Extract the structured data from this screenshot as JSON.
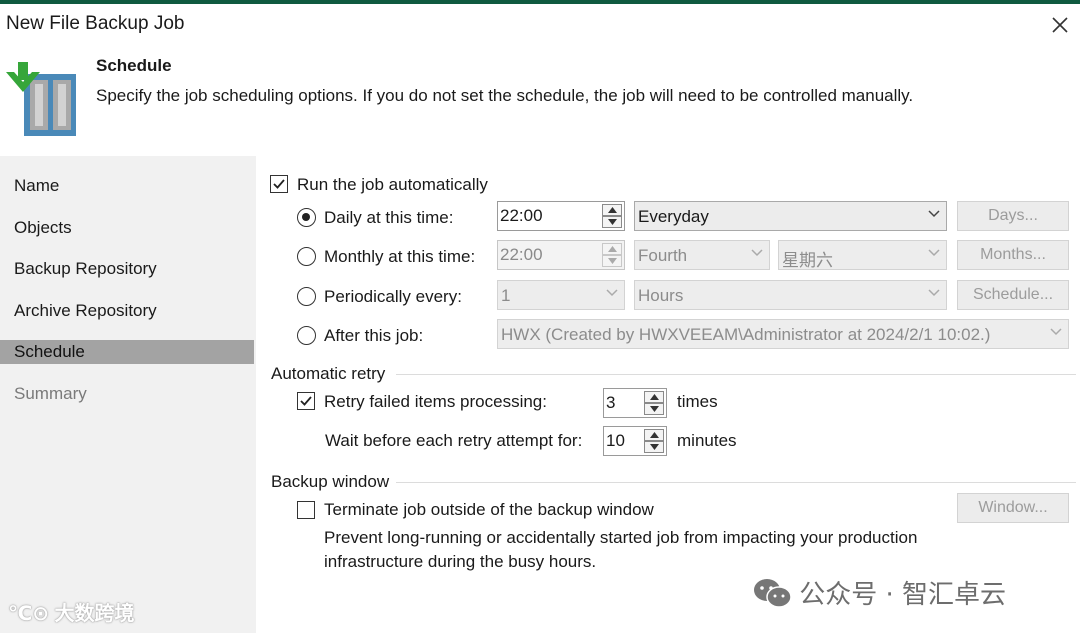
{
  "window": {
    "title": "New File Backup Job",
    "accent_color": "#0f5a40"
  },
  "header": {
    "title": "Schedule",
    "description": "Specify the job scheduling options. If you do not set the schedule, the job will need to be controlled manually.",
    "icon": "backup-job-icon"
  },
  "nav": {
    "items": [
      {
        "label": "Name",
        "state": "normal"
      },
      {
        "label": "Objects",
        "state": "normal"
      },
      {
        "label": "Backup Repository",
        "state": "normal"
      },
      {
        "label": "Archive Repository",
        "state": "normal"
      },
      {
        "label": "Schedule",
        "state": "active"
      },
      {
        "label": "Summary",
        "state": "disabled"
      }
    ]
  },
  "schedule": {
    "run_auto_label": "Run the job automatically",
    "run_auto_checked": true,
    "daily": {
      "label": "Daily at this time:",
      "selected": true,
      "time": "22:00",
      "frequency": "Everyday",
      "button": "Days..."
    },
    "monthly": {
      "label": "Monthly at this time:",
      "selected": false,
      "time": "22:00",
      "week": "Fourth",
      "day": "星期六",
      "button": "Months..."
    },
    "periodic": {
      "label": "Periodically every:",
      "selected": false,
      "value": "1",
      "unit": "Hours",
      "button": "Schedule..."
    },
    "after": {
      "label": "After this job:",
      "selected": false,
      "job": "HWX (Created by HWXVEEAM\\Administrator at 2024/2/1 10:02.)"
    }
  },
  "retry": {
    "section_label": "Automatic retry",
    "retry_label": "Retry failed items processing:",
    "retry_checked": true,
    "retry_count": "3",
    "times_label": "times",
    "wait_label": "Wait before each retry attempt for:",
    "wait_value": "10",
    "minutes_label": "minutes"
  },
  "backup_window": {
    "section_label": "Backup window",
    "terminate_label": "Terminate job outside of the backup window",
    "terminate_checked": false,
    "button": "Window...",
    "note_line1": "Prevent long-running or accidentally started job from impacting your production",
    "note_line2": "infrastructure during the busy hours."
  },
  "watermarks": {
    "bottom_right": "公众号 · 智汇卓云",
    "bottom_left": "大数跨境"
  }
}
